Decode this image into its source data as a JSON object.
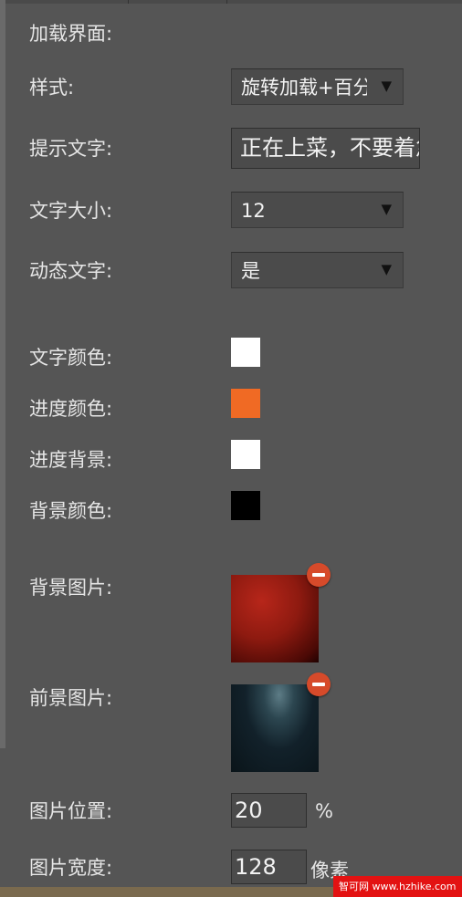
{
  "labels": {
    "loading_ui": "加载界面:",
    "style": "样式:",
    "hint_text": "提示文字:",
    "text_size": "文字大小:",
    "dynamic_text": "动态文字:",
    "text_color": "文字颜色:",
    "progress_color": "进度颜色:",
    "progress_background": "进度背景:",
    "background_color": "背景颜色:",
    "background_image": "背景图片:",
    "foreground_image": "前景图片:",
    "image_position": "图片位置:",
    "image_width": "图片宽度:"
  },
  "fields": {
    "style_value": "旋转加载+百分比",
    "hint_text_value": "正在上菜，不要着急",
    "text_size_value": "12",
    "dynamic_text_value": "是",
    "image_position_value": "20",
    "image_position_unit": "%",
    "image_width_value": "128",
    "image_width_unit": "像素"
  },
  "colors": {
    "text_color": "#ffffff",
    "progress_color": "#f06a24",
    "progress_background": "#ffffff",
    "background_color": "#000000"
  },
  "icons": {
    "dropdown": "▼"
  },
  "watermark": "智可网 www.hzhike.com"
}
